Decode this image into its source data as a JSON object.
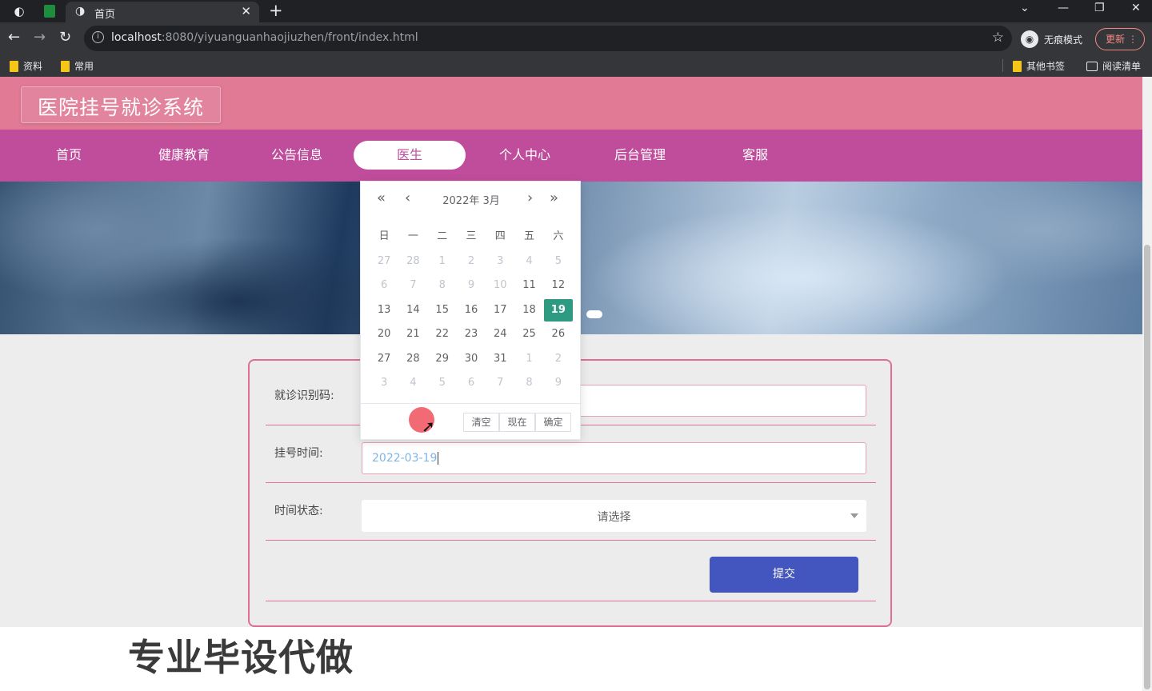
{
  "browser": {
    "tab_title": "首页",
    "url_host": "localhost",
    "url_rest": ":8080/yiyuanguanhaojiuzhen/front/index.html",
    "incognito_label": "无痕模式",
    "update_label": "更新",
    "bookmarks": [
      "资料",
      "常用"
    ],
    "other_bookmarks": "其他书签",
    "reading_list": "阅读清单"
  },
  "site": {
    "logo": "医院挂号就诊系统",
    "nav": [
      "首页",
      "健康教育",
      "公告信息",
      "医生",
      "个人中心",
      "后台管理",
      "客服"
    ],
    "active_nav": "医生"
  },
  "form": {
    "code_label": "就诊识别码:",
    "code_value": "",
    "time_label": "挂号时间:",
    "time_value": "2022-03-19",
    "status_label": "时间状态:",
    "status_placeholder": "请选择",
    "submit_label": "提交"
  },
  "datepicker": {
    "title": "2022年  3月",
    "weekdays": [
      "日",
      "一",
      "二",
      "三",
      "四",
      "五",
      "六"
    ],
    "weeks": [
      [
        {
          "d": "27",
          "dim": true
        },
        {
          "d": "28",
          "dim": true
        },
        {
          "d": "1",
          "dim": true
        },
        {
          "d": "2",
          "dim": true
        },
        {
          "d": "3",
          "dim": true
        },
        {
          "d": "4",
          "dim": true
        },
        {
          "d": "5",
          "dim": true
        }
      ],
      [
        {
          "d": "6",
          "dim": true
        },
        {
          "d": "7",
          "dim": true
        },
        {
          "d": "8",
          "dim": true
        },
        {
          "d": "9",
          "dim": true
        },
        {
          "d": "10",
          "dim": true
        },
        {
          "d": "11"
        },
        {
          "d": "12"
        }
      ],
      [
        {
          "d": "13"
        },
        {
          "d": "14"
        },
        {
          "d": "15"
        },
        {
          "d": "16"
        },
        {
          "d": "17"
        },
        {
          "d": "18"
        },
        {
          "d": "19",
          "sel": true
        }
      ],
      [
        {
          "d": "20"
        },
        {
          "d": "21"
        },
        {
          "d": "22"
        },
        {
          "d": "23"
        },
        {
          "d": "24"
        },
        {
          "d": "25"
        },
        {
          "d": "26"
        }
      ],
      [
        {
          "d": "27"
        },
        {
          "d": "28"
        },
        {
          "d": "29"
        },
        {
          "d": "30"
        },
        {
          "d": "31"
        },
        {
          "d": "1",
          "dim": true
        },
        {
          "d": "2",
          "dim": true
        }
      ],
      [
        {
          "d": "3",
          "dim": true
        },
        {
          "d": "4",
          "dim": true
        },
        {
          "d": "5",
          "dim": true
        },
        {
          "d": "6",
          "dim": true
        },
        {
          "d": "7",
          "dim": true
        },
        {
          "d": "8",
          "dim": true
        },
        {
          "d": "9",
          "dim": true
        }
      ]
    ],
    "buttons": [
      "清空",
      "现在",
      "确定"
    ]
  },
  "watermark": "专业毕设代做",
  "colors": {
    "header": "#e07a95",
    "navbar": "#c04d9c",
    "submit": "#4355be",
    "selected_day": "#2f9a82"
  }
}
